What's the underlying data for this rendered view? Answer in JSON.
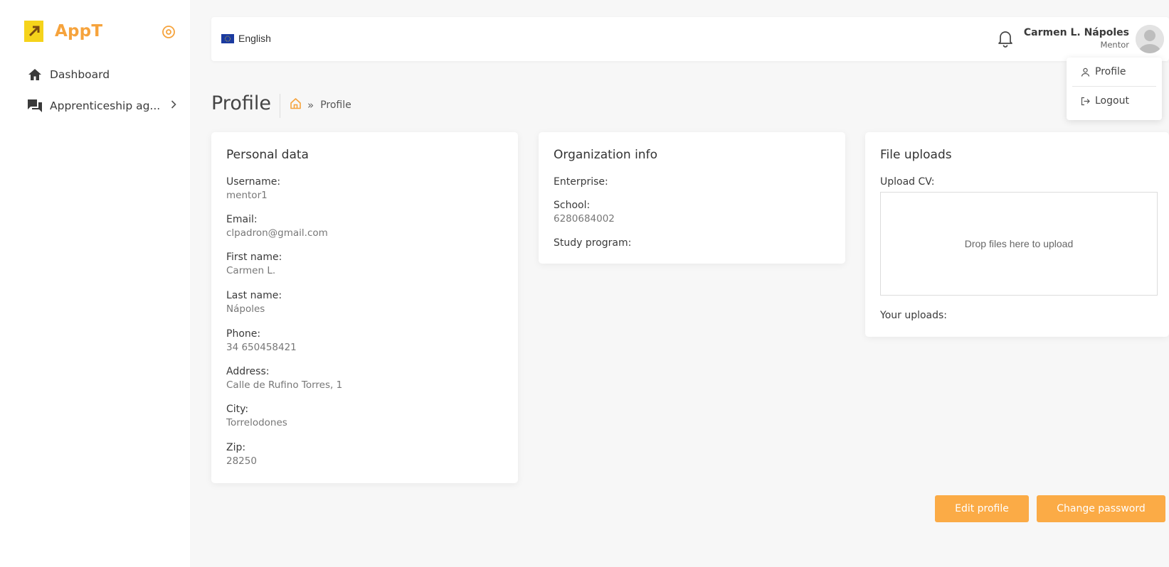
{
  "app": {
    "name": "AppT",
    "accent_color": "#f6a33c",
    "button_color": "#fbab46"
  },
  "sidebar": {
    "items": [
      {
        "label": "Dashboard",
        "icon": "home-icon"
      },
      {
        "label": "Apprenticeship ag...",
        "icon": "chat-icon"
      }
    ]
  },
  "topbar": {
    "language": "English",
    "user_name": "Carmen L. Nápoles",
    "user_role": "Mentor"
  },
  "user_menu": {
    "profile": "Profile",
    "logout": "Logout"
  },
  "page": {
    "title": "Profile",
    "breadcrumb_current": "Profile"
  },
  "personal_data": {
    "title": "Personal data",
    "fields": [
      {
        "label": "Username:",
        "value": "mentor1"
      },
      {
        "label": "Email:",
        "value": "clpadron@gmail.com"
      },
      {
        "label": "First name:",
        "value": "Carmen L."
      },
      {
        "label": "Last name:",
        "value": "Nápoles"
      },
      {
        "label": "Phone:",
        "value": "34 650458421"
      },
      {
        "label": "Address:",
        "value": "Calle de Rufino Torres, 1"
      },
      {
        "label": "City:",
        "value": "Torrelodones"
      },
      {
        "label": "Zip:",
        "value": "28250"
      }
    ]
  },
  "organization_info": {
    "title": "Organization info",
    "fields": [
      {
        "label": "Enterprise:",
        "value": ""
      },
      {
        "label": "School:",
        "value": "6280684002"
      },
      {
        "label": "Study program:",
        "value": ""
      }
    ]
  },
  "file_uploads": {
    "title": "File uploads",
    "upload_cv_label": "Upload CV:",
    "dropzone_text": "Drop files here to upload",
    "your_uploads_label": "Your uploads:"
  },
  "actions": {
    "edit_profile": "Edit profile",
    "change_password": "Change password"
  }
}
